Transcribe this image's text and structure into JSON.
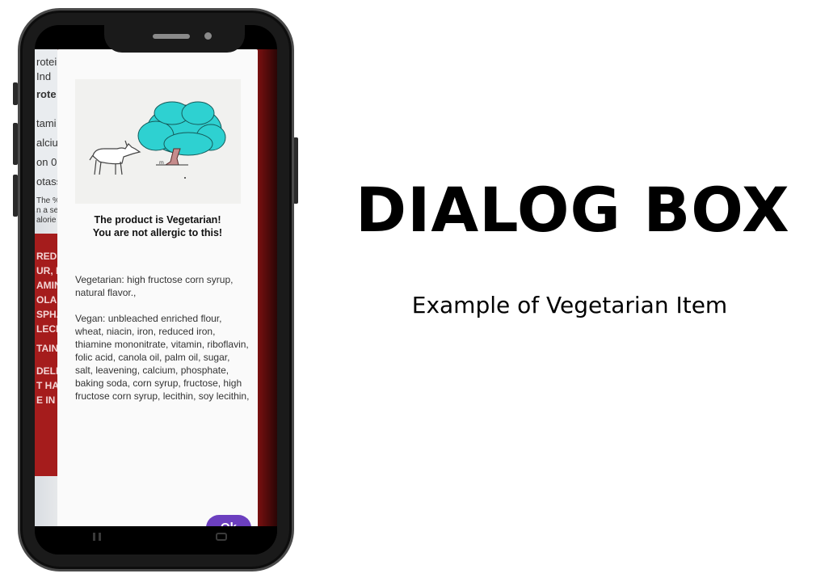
{
  "dialog": {
    "title_line1": "The product is Vegetarian!",
    "title_line2": "You are not allergic to this!",
    "vegetarian_text": "Vegetarian:  high fructose corn syrup,  natural flavor.,",
    "vegan_text": "Vegan: unbleached enriched flour, wheat, niacin, iron, reduced iron, thiamine mononitrate, vitamin, riboflavin, folic acid, canola oil, palm oil, sugar, salt, leavening, calcium, phosphate, baking soda, corn syrup, fructose, high fructose corn syrup, lecithin, soy lecithin,",
    "ok_label": "Ok",
    "ok_color": "#6c3fbf"
  },
  "headline": {
    "title": "DIALOG BOX",
    "subtitle": "Example of Vegetarian Item"
  },
  "background_fragments": [
    "rotei",
    "Ind",
    "rote",
    "tami",
    "alciu",
    "on 0",
    "otass",
    "The %",
    "n a se",
    "alorie",
    "REDIE",
    "UR, NI",
    "AMIN",
    "OLA O",
    "SPHA",
    "LECIT",
    "TAINS",
    "DELE",
    "T HAN",
    "E IN"
  ],
  "icons": {
    "illustration": "goat-under-tree-illustration",
    "nav_recents": "recents-icon",
    "nav_home": "home-icon"
  }
}
